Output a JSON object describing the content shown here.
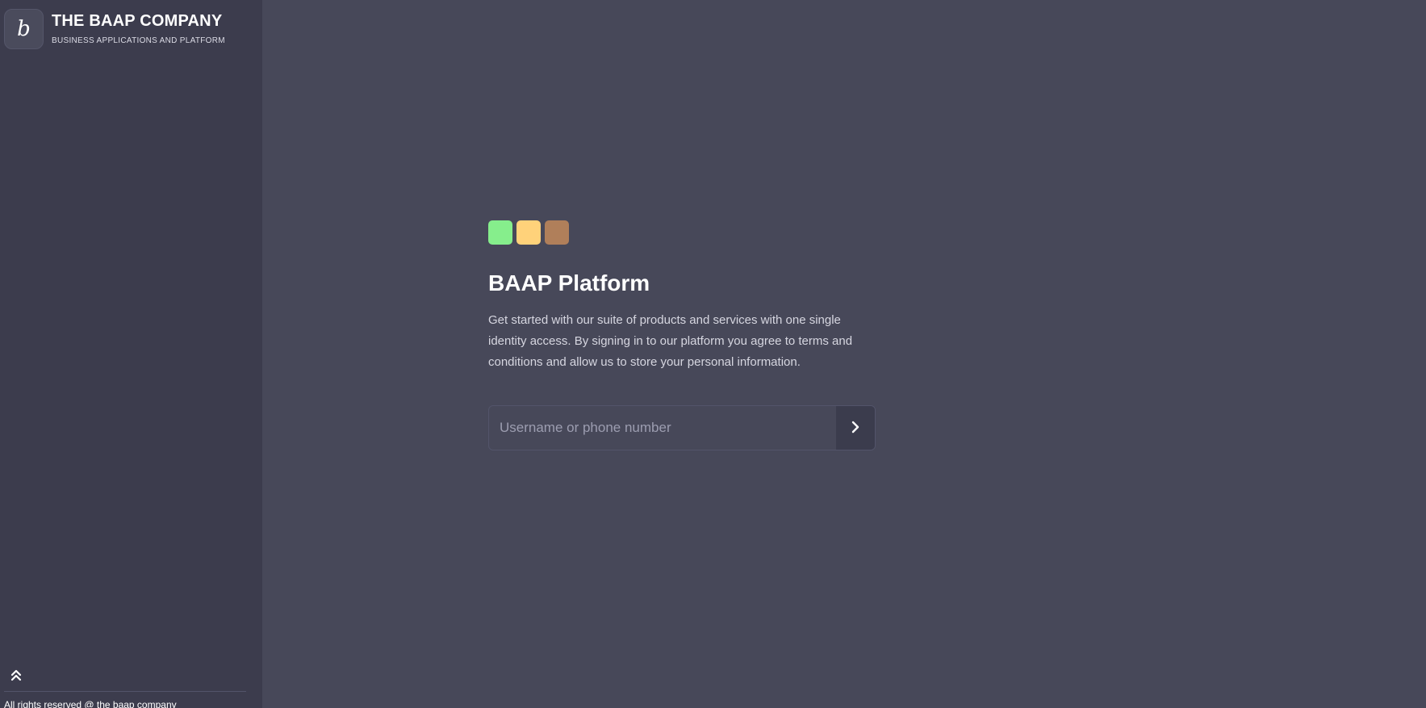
{
  "sidebar": {
    "logo_letter": "b",
    "brand_title": "THE BAAP COMPANY",
    "brand_subtitle": "BUSINESS APPLICATIONS AND PLATFORM",
    "collapse_icon": "double-chevron-up-icon",
    "footer": "All rights reserved @ the baap company"
  },
  "main": {
    "dots": [
      {
        "name": "green-square",
        "color": "#86ee8c"
      },
      {
        "name": "yellow-square",
        "color": "#ffd27a"
      },
      {
        "name": "brown-square",
        "color": "#b07f5a"
      }
    ],
    "title": "BAAP Platform",
    "description": "Get started with our suite of products and services with one single identity access. By signing in to our platform you agree to terms and conditions and allow us to store your personal information.",
    "login": {
      "value": "",
      "placeholder": "Username or phone number",
      "submit_icon": "chevron-right-icon"
    }
  }
}
